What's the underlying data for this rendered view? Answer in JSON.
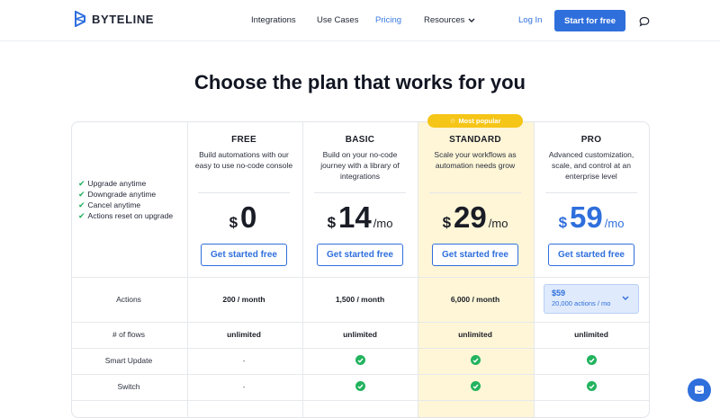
{
  "brand": {
    "name": "BYTELINE"
  },
  "nav": {
    "links": [
      {
        "label": "Integrations"
      },
      {
        "label": "Use Cases"
      },
      {
        "label": "Pricing"
      },
      {
        "label": "Resources"
      }
    ],
    "login": "Log In",
    "start": "Start for free",
    "chat_icon": "chat-bubble-icon"
  },
  "headline": "Choose the plan that works for you",
  "badge": "Most popular",
  "features": [
    "Upgrade anytime",
    "Downgrade anytime",
    "Cancel anytime",
    "Actions reset on upgrade"
  ],
  "plans": [
    {
      "name": "FREE",
      "desc": "Build automations with our easy to use no-code console",
      "currency": "$",
      "amount": "0",
      "period": "",
      "cta": "Get started free"
    },
    {
      "name": "BASIC",
      "desc": "Build on your no-code journey with a library of integrations",
      "currency": "$",
      "amount": "14",
      "period": "/mo",
      "cta": "Get started free"
    },
    {
      "name": "STANDARD",
      "desc": "Scale your workflows as automation needs grow",
      "currency": "$",
      "amount": "29",
      "period": "/mo",
      "cta": "Get started free"
    },
    {
      "name": "PRO",
      "desc": "Advanced customization, scale, and control at an enterprise level",
      "currency": "$",
      "amount": "59",
      "period": "/mo",
      "cta": "Get started free"
    }
  ],
  "rows": [
    {
      "label": "Actions",
      "values": [
        "200 / month",
        "1,500 / month",
        "6,000 / month"
      ]
    },
    {
      "label": "# of flows",
      "values": [
        "unlimited",
        "unlimited",
        "unlimited",
        "unlimited"
      ]
    },
    {
      "label": "Smart Update",
      "values": [
        "-",
        "check",
        "check",
        "check"
      ]
    },
    {
      "label": "Switch",
      "values": [
        "-",
        "check",
        "check",
        "check"
      ]
    }
  ],
  "pro_select": {
    "value": "$59",
    "sub": "20,000 actions / mo"
  },
  "colors": {
    "accent": "#2f6fdc",
    "highlight": "#fef6d7",
    "badge": "#f5c518",
    "check": "#22b35e"
  }
}
